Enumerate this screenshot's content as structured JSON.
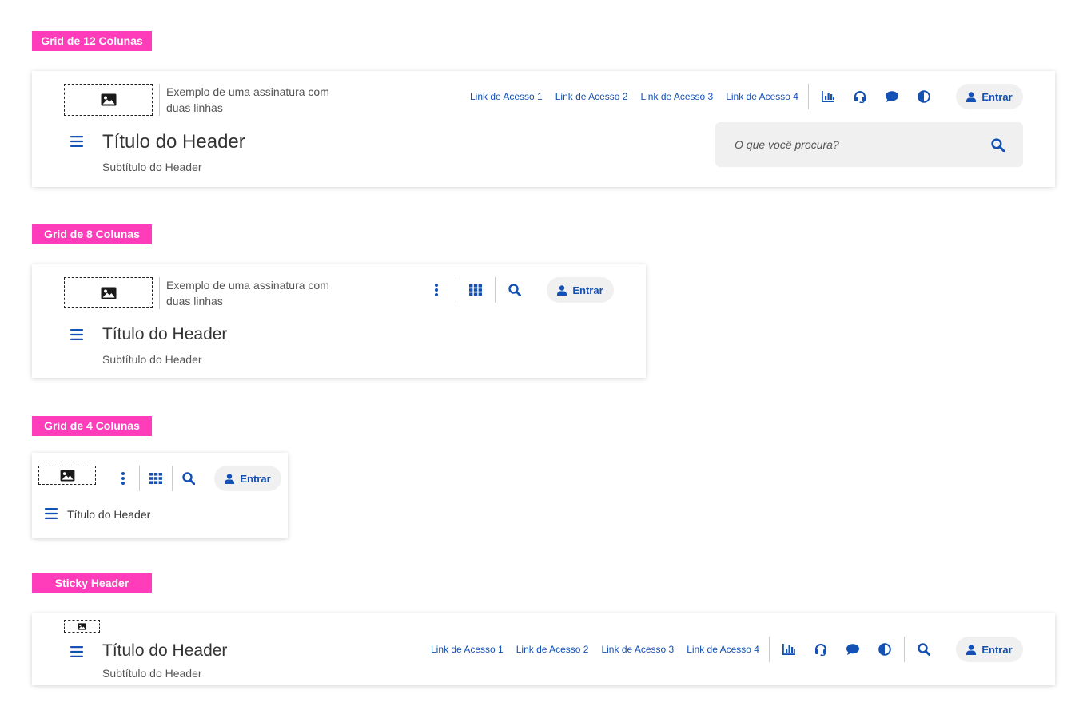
{
  "colors": {
    "accent": "#1351b4",
    "tag_bg": "#ff3dbb",
    "button_bg": "#f0f0f0"
  },
  "sections": {
    "grid12": {
      "tag": "Grid de 12 Colunas",
      "signature": [
        "Exemplo de uma assinatura com",
        "duas linhas"
      ],
      "title": "Título do Header",
      "subtitle": "Subtítulo do Header",
      "links": [
        "Link de Acesso 1",
        "Link de Acesso 2",
        "Link de Acesso 3",
        "Link de Acesso 4"
      ],
      "icons": [
        "chart-icon",
        "headset-icon",
        "chat-icon",
        "contrast-icon"
      ],
      "login": "Entrar",
      "search_placeholder": "O que você procura?"
    },
    "grid8": {
      "tag": "Grid de 8 Colunas",
      "signature": [
        "Exemplo de uma assinatura com",
        "duas linhas"
      ],
      "title": "Título do Header",
      "subtitle": "Subtítulo do Header",
      "icons": [
        "kebab-menu-icon",
        "apps-grid-icon",
        "search-icon"
      ],
      "login": "Entrar"
    },
    "grid4": {
      "tag": "Grid de 4 Colunas",
      "title": "Título do Header",
      "icons": [
        "kebab-menu-icon",
        "apps-grid-icon",
        "search-icon"
      ],
      "login": "Entrar"
    },
    "sticky": {
      "tag": "Sticky Header",
      "title": "Título do Header",
      "subtitle": "Subtítulo do Header",
      "links": [
        "Link de Acesso 1",
        "Link de Acesso 2",
        "Link de Acesso 3",
        "Link de Acesso 4"
      ],
      "icons": [
        "chart-icon",
        "headset-icon",
        "chat-icon",
        "contrast-icon",
        "search-icon"
      ],
      "login": "Entrar"
    }
  }
}
